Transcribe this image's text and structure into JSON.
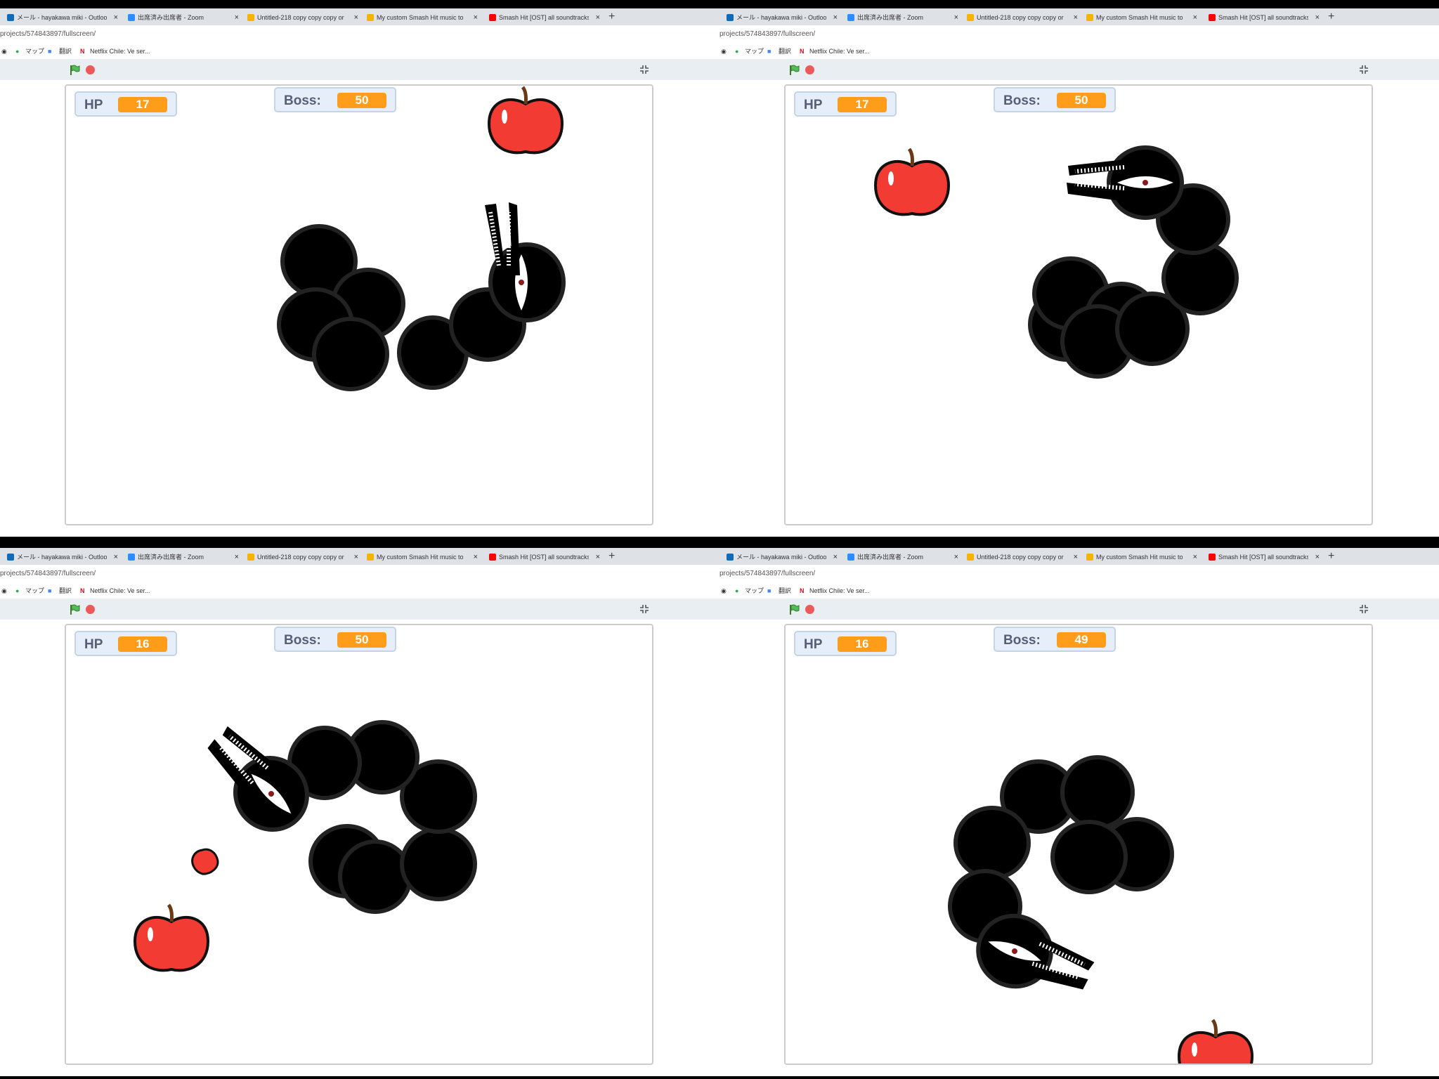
{
  "browser": {
    "tabs": [
      {
        "title": "メール - hayakawa miki - Outlook",
        "color": "#0f6cbd"
      },
      {
        "title": "出席済み出席者 - Zoom",
        "color": "#2d8cff"
      },
      {
        "title": "Untitled-218 copy copy copy or",
        "color": "#f5b400"
      },
      {
        "title": "My custom Smash Hit music to",
        "color": "#f5b400"
      },
      {
        "title": "Smash Hit [OST] all soundtracks",
        "color": "#ff0000"
      }
    ],
    "new_tab": "+",
    "close_glyph": "×",
    "address": "projects/574843897/fullscreen/",
    "bookmarks": [
      "マップ",
      "翻訳",
      "Netflix Chile: Ve ser..."
    ]
  },
  "frames": [
    {
      "hp_label": "HP",
      "hp": "17",
      "boss_label": "Boss:",
      "boss": "50"
    },
    {
      "hp_label": "HP",
      "hp": "17",
      "boss_label": "Boss:",
      "boss": "50"
    },
    {
      "hp_label": "HP",
      "hp": "16",
      "boss_label": "Boss:",
      "boss": "50"
    },
    {
      "hp_label": "HP",
      "hp": "16",
      "boss_label": "Boss:",
      "boss": "49"
    }
  ],
  "colors": {
    "apple": "#f23b32",
    "monitor_value": "#ff9c1a",
    "serpent": "#000000"
  }
}
